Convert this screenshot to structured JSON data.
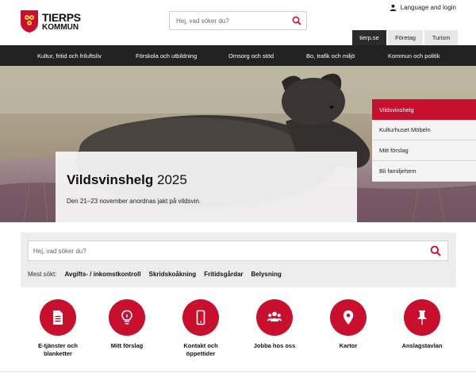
{
  "header": {
    "logo_line1": "TIERPS",
    "logo_line2": "KOMMUN",
    "search_placeholder": "Hej, vad söker du?",
    "language_link": "Language and login",
    "site_tabs": [
      {
        "label": "tierp.se",
        "active": true
      },
      {
        "label": "Företag",
        "active": false
      },
      {
        "label": "Turism",
        "active": false
      }
    ]
  },
  "main_nav": [
    "Kultur, fritid och friluftsliv",
    "Förskola och utbildning",
    "Omsorg och stöd",
    "Bo, trafik och miljö",
    "Kommun och politik"
  ],
  "hero": {
    "title_bold": "Vildsvinshelg",
    "title_rest": " 2025",
    "text": "Den 21–23 november anordnas jakt på vildsvin.",
    "quick_links": [
      {
        "label": "Vildsvinshelg",
        "active": true
      },
      {
        "label": "Kulturhuset Möbeln",
        "active": false
      },
      {
        "label": "Mitt förslag",
        "active": false
      },
      {
        "label": "Bli familjehem",
        "active": false
      }
    ]
  },
  "search_panel": {
    "placeholder": "Hej, vad söker du?",
    "popular_label": "Mest sökt:",
    "popular": [
      "Avgifts- / inkomstkontroll",
      "Skridskoåkning",
      "Fritidsgårdar",
      "Belysning"
    ]
  },
  "tiles": [
    {
      "label": "E-tjänster och blanketter",
      "icon": "document-icon"
    },
    {
      "label": "Mitt förslag",
      "icon": "lightbulb-icon"
    },
    {
      "label": "Kontakt och öppettider",
      "icon": "phone-icon"
    },
    {
      "label": "Jobba hos oss",
      "icon": "people-icon"
    },
    {
      "label": "Kartor",
      "icon": "map-pin-icon"
    },
    {
      "label": "Anslagstavlan",
      "icon": "pushpin-icon"
    }
  ],
  "colors": {
    "accent": "#c8102e",
    "nav_bg": "#222222",
    "panel_bg": "#ededed"
  }
}
